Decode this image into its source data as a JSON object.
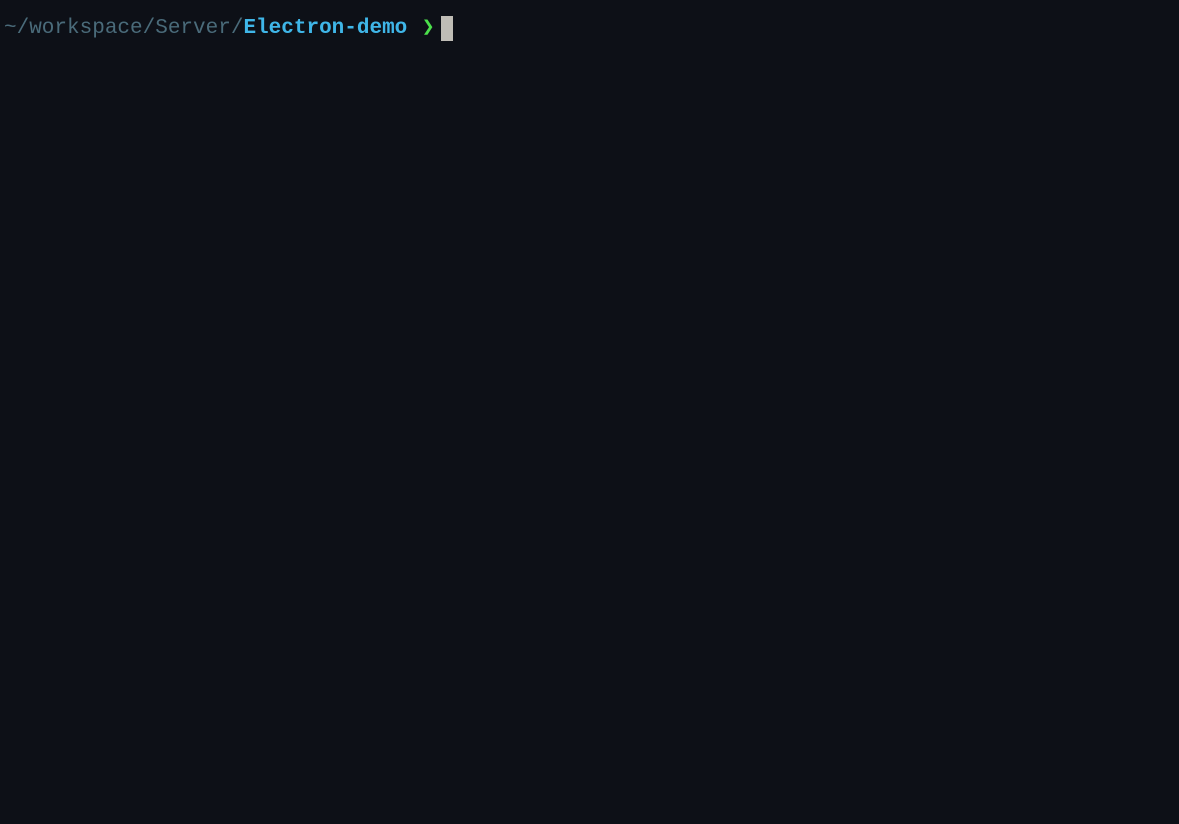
{
  "prompt": {
    "path_prefix": "~/workspace/Server/",
    "current_dir": "Electron-demo",
    "chevron": "❯",
    "input_value": ""
  }
}
